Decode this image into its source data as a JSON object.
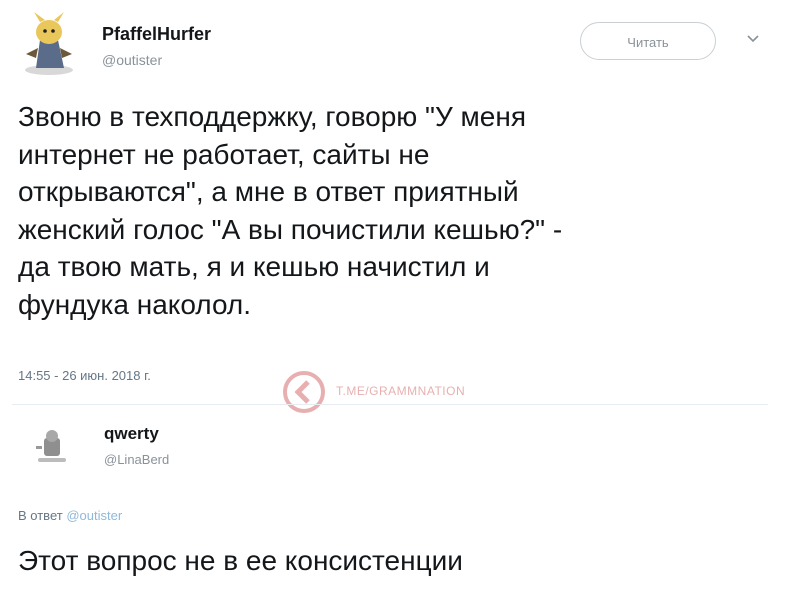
{
  "tweet": {
    "author_name": "PfaffelHurfer",
    "author_handle": "@outister",
    "follow_label": "Читать",
    "text": "Звоню в техподдержку, говорю \"У меня\nинтернет не работает, сайты не\nоткрываются\", а мне в ответ приятный\nженский голос \"А вы почистили кешью?\" -\nда твою мать, я и кешью начистил и\nфундука наколол.",
    "timestamp": "14:55 - 26 июн. 2018 г."
  },
  "watermark": {
    "text": "T.ME/GRAMMNATION"
  },
  "reply": {
    "author_name": "qwerty",
    "author_handle": "@LinaBerd",
    "reply_to_prefix": "В ответ",
    "reply_to_handle": "@outister",
    "text": "Этот вопрос не в ее консистенции"
  },
  "colors": {
    "text": "#14171a",
    "muted": "#657786",
    "handle": "#8a9299",
    "mention": "#8fb8d8",
    "watermark": "#d46f6f",
    "divider": "#e6ecf0"
  }
}
